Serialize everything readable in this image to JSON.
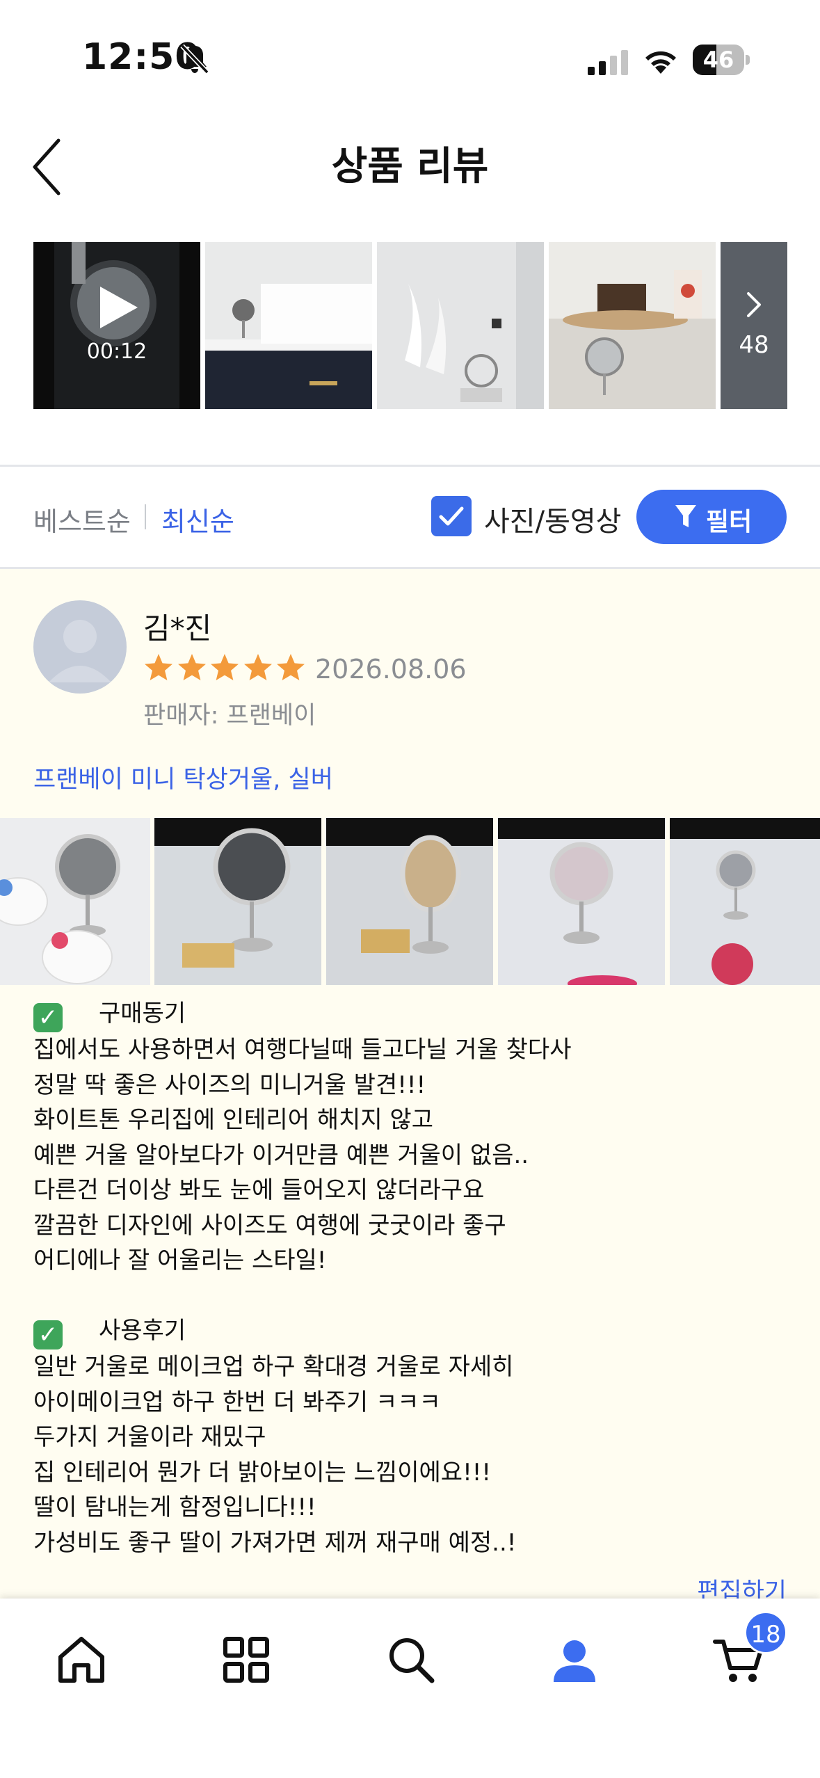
{
  "status_bar": {
    "time": "12:50",
    "battery_percent": "46",
    "battery_level": 0.46
  },
  "header": {
    "title": "상품 리뷰",
    "back_icon": "chevron-left-icon"
  },
  "media_strip": {
    "video_duration": "00:12",
    "more_count": "48"
  },
  "sort": {
    "best_label": "베스트순",
    "latest_label": "최신순",
    "photo_filter_label": "사진/동영상",
    "photo_filter_checked": true,
    "filter_button_label": "필터"
  },
  "review": {
    "reviewer_name": "김*진",
    "rating": 5,
    "date": "2026.08.06",
    "seller": "판매자: 프랜베이",
    "product_name": "프랜베이 미니 탁상거울, 실버",
    "section1_title": "구매동기",
    "section1_lines": [
      "집에서도 사용하면서 여행다닐때 들고다닐 거울 찾다사",
      "정말 딱 좋은 사이즈의 미니거울 발견!!!",
      "화이트톤 우리집에 인테리어 해치지 않고",
      "예쁜 거울 알아보다가 이거만큼 예쁜 거울이 없음..",
      "다른건 더이상 봐도 눈에 들어오지 않더라구요",
      "깔끔한 디자인에 사이즈도 여행에 굿굿이라 좋구",
      "어디에나 잘 어울리는 스타일!"
    ],
    "section2_title": "사용후기",
    "section2_lines": [
      "일반 거울로 메이크업 하구 확대경 거울로 자세히",
      "아이메이크업 하구 한번 더 봐주기 ㅋㅋㅋ",
      "두가지 거울이라 재밌구",
      "집 인테리어 뭔가 더 밝아보이는 느낌이에요!!!",
      "딸이 탐내는게 함정입니다!!!",
      "가성비도 좋구 딸이 가져가면 제꺼 재구매 예정..!"
    ],
    "edit_label": "편집하기"
  },
  "bottom_nav": {
    "items": [
      "home-icon",
      "category-grid-icon",
      "search-icon",
      "my-page-icon",
      "cart-icon"
    ],
    "active": "my-page-icon",
    "cart_count": "18"
  },
  "colors": {
    "accent": "#3c6df0",
    "link": "#3b63e6",
    "review_bg": "#fffdf1",
    "star": "#f39a3b"
  }
}
